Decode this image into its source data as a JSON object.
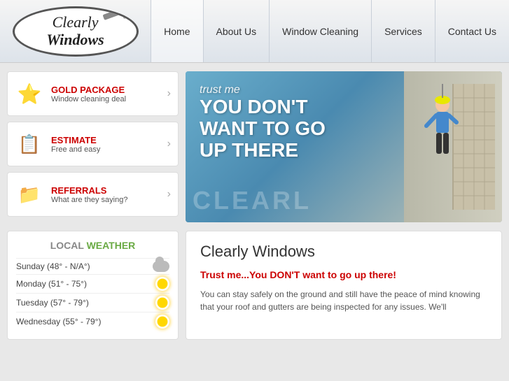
{
  "header": {
    "logo_text_line1": "Clearly",
    "logo_text_line2": "Windows",
    "nav_items": [
      {
        "label": "Home",
        "href": "#",
        "active": true
      },
      {
        "label": "About Us",
        "href": "#",
        "active": false
      },
      {
        "label": "Window Cleaning",
        "href": "#",
        "active": false
      },
      {
        "label": "Services",
        "href": "#",
        "active": false
      },
      {
        "label": "Contact Us",
        "href": "#",
        "active": false
      }
    ]
  },
  "sidebar": {
    "promo_boxes": [
      {
        "id": "gold",
        "icon": "⭐",
        "title": "GOLD PACKAGE",
        "subtitle": "Window cleaning deal"
      },
      {
        "id": "estimate",
        "icon": "📋",
        "title": "ESTIMATE",
        "subtitle": "Free and easy"
      },
      {
        "id": "referrals",
        "icon": "📁",
        "title": "REFERRALS",
        "subtitle": "What are they saying?"
      }
    ]
  },
  "hero": {
    "trust_me": "trust me",
    "main_text_line1": "YOU DON'T",
    "main_text_line2": "WANT TO GO",
    "main_text_line3": "UP THERE",
    "watermark": "CLEARL"
  },
  "weather": {
    "title_local": "LOCAL",
    "title_weather": "WEATHER",
    "rows": [
      {
        "day": "Sunday (48° - N/A°)",
        "icon": "cloud"
      },
      {
        "day": "Monday (51° - 75°)",
        "icon": "sun"
      },
      {
        "day": "Tuesday (57° - 79°)",
        "icon": "sun"
      },
      {
        "day": "Wednesday (55° - 79°)",
        "icon": "sun"
      }
    ]
  },
  "content": {
    "heading": "Clearly Windows",
    "tagline": "Trust me...You DON'T want to go up there!",
    "body": "You can stay safely on the ground and still have the peace of mind knowing that your roof and gutters are being inspected for any issues. We'll"
  }
}
